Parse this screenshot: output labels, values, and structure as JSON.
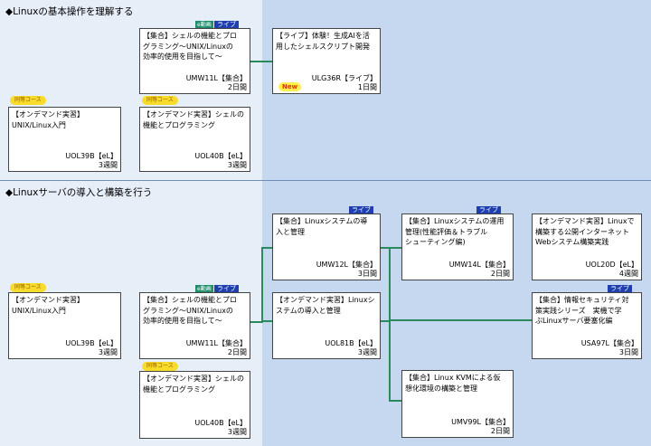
{
  "sections": [
    {
      "title": "◆Linuxの基本操作を理解する"
    },
    {
      "title": "◆Linuxサーバの導入と構築を行う"
    }
  ],
  "colors": {
    "left_bg": "#e6eef8",
    "right_bg": "#c6d8ef",
    "connector": "#2a8a5c",
    "live_tag": "#1f3fb0",
    "ev_tag": "#1e8f6a",
    "same_tag": "#f7dc2b"
  },
  "tags": {
    "live": "ライブ",
    "ev": "e動画",
    "same": "同等コース",
    "new": "New"
  },
  "cards": {
    "s1_mw11l": {
      "title": "【集合】シェルの機能とプロ\nグラミング～UNIX/Linuxの\n効率的使用を目指して～",
      "code": "UMW11L【集合】",
      "days": "2日間"
    },
    "s1_lg36r": {
      "title": "【ライブ】体験！生成AIを活\n用したシェルスクリプト開発",
      "code": "ULG36R【ライブ】",
      "days": "1日間"
    },
    "s1_ol39b": {
      "title": "【オンデマンド実習】\nUNIX/Linux入門",
      "code": "UOL39B【eL】",
      "days": "3週間"
    },
    "s1_ol40b": {
      "title": "【オンデマンド実習】シェルの\n機能とプログラミング",
      "code": "UOL40B【eL】",
      "days": "3週間"
    },
    "s2_ol39b": {
      "title": "【オンデマンド実習】\nUNIX/Linux入門",
      "code": "UOL39B【eL】",
      "days": "3週間"
    },
    "s2_mw11l": {
      "title": "【集合】シェルの機能とプロ\nグラミング～UNIX/Linuxの\n効率的使用を目指して～",
      "code": "UMW11L【集合】",
      "days": "2日間"
    },
    "s2_ol40b": {
      "title": "【オンデマンド実習】シェルの\n機能とプログラミング",
      "code": "UOL40B【eL】",
      "days": "3週間"
    },
    "s2_mw12l": {
      "title": "【集合】Linuxシステムの導\n入と管理",
      "code": "UMW12L【集合】",
      "days": "3日間"
    },
    "s2_ol81b": {
      "title": "【オンデマンド実習】Linuxシ\nステムの導入と管理",
      "code": "UOL81B【eL】",
      "days": "3週間"
    },
    "s2_mw14l": {
      "title": "【集合】Linuxシステムの運用\n管理(性能評価＆トラブル\nシューティング編)",
      "code": "UMW14L【集合】",
      "days": "2日間"
    },
    "s2_mv99l": {
      "title": "【集合】Linux KVMによる仮\n想化環境の構築と管理",
      "code": "UMV99L【集合】",
      "days": "2日間"
    },
    "s2_ol20d": {
      "title": "【オンデマンド実習】Linuxで\n構築する公開インターネット\nWebシステム構築実践",
      "code": "UOL20D【eL】",
      "days": "4週間"
    },
    "s2_sa97l": {
      "title": "【集合】情報セキュリティ対\n策実践シリーズ　実機で学\nぶLinuxサーバ要塞化編",
      "code": "USA97L【集合】",
      "days": "3日間"
    }
  }
}
